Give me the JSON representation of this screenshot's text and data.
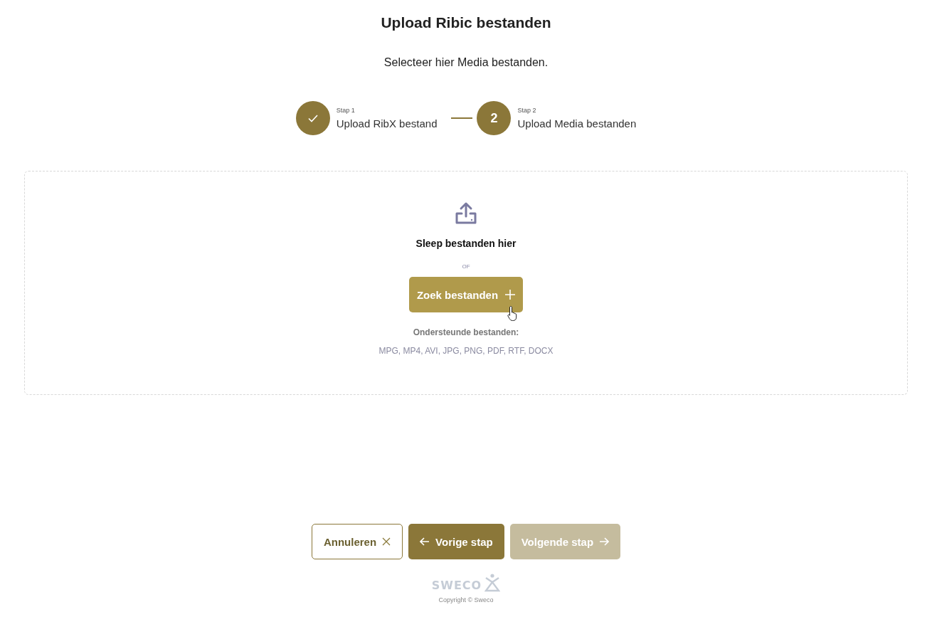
{
  "title": "Upload Ribic bestanden",
  "subtitle": "Selecteer hier Media bestanden.",
  "steps": [
    {
      "label": "Stap 1",
      "title": "Upload RibX bestand",
      "completed": true
    },
    {
      "label": "Stap 2",
      "title": "Upload Media bestanden",
      "number": "2",
      "completed": false
    }
  ],
  "dropzone": {
    "heading": "Sleep bestanden hier",
    "separator": "OF",
    "button": "Zoek bestanden",
    "supported_label": "Ondersteunde bestanden:",
    "supported_types": "MPG, MP4, AVI, JPG, PNG, PDF, RTF, DOCX"
  },
  "buttons": [
    {
      "kind": "cancel",
      "label": "Annuleren",
      "disabled": false
    },
    {
      "kind": "back",
      "label": "Vorige stap",
      "disabled": false
    },
    {
      "kind": "next",
      "label": "Volgende stap",
      "disabled": true
    }
  ],
  "footer": {
    "logo": "SWECO",
    "copyright": "Copyright © Sweco"
  }
}
